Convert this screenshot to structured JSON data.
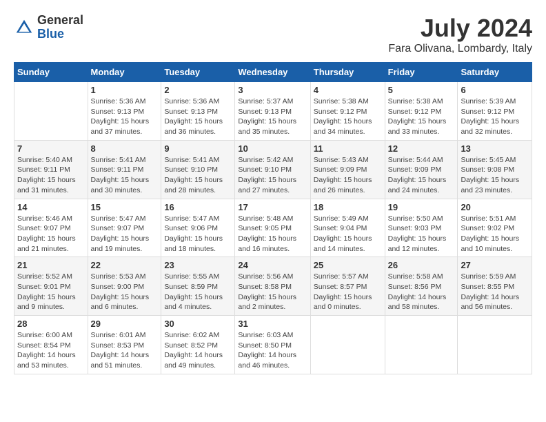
{
  "header": {
    "logo_line1": "General",
    "logo_line2": "Blue",
    "month_year": "July 2024",
    "location": "Fara Olivana, Lombardy, Italy"
  },
  "days_of_week": [
    "Sunday",
    "Monday",
    "Tuesday",
    "Wednesday",
    "Thursday",
    "Friday",
    "Saturday"
  ],
  "weeks": [
    [
      {
        "day": "",
        "content": ""
      },
      {
        "day": "1",
        "content": "Sunrise: 5:36 AM\nSunset: 9:13 PM\nDaylight: 15 hours\nand 37 minutes."
      },
      {
        "day": "2",
        "content": "Sunrise: 5:36 AM\nSunset: 9:13 PM\nDaylight: 15 hours\nand 36 minutes."
      },
      {
        "day": "3",
        "content": "Sunrise: 5:37 AM\nSunset: 9:13 PM\nDaylight: 15 hours\nand 35 minutes."
      },
      {
        "day": "4",
        "content": "Sunrise: 5:38 AM\nSunset: 9:12 PM\nDaylight: 15 hours\nand 34 minutes."
      },
      {
        "day": "5",
        "content": "Sunrise: 5:38 AM\nSunset: 9:12 PM\nDaylight: 15 hours\nand 33 minutes."
      },
      {
        "day": "6",
        "content": "Sunrise: 5:39 AM\nSunset: 9:12 PM\nDaylight: 15 hours\nand 32 minutes."
      }
    ],
    [
      {
        "day": "7",
        "content": "Sunrise: 5:40 AM\nSunset: 9:11 PM\nDaylight: 15 hours\nand 31 minutes."
      },
      {
        "day": "8",
        "content": "Sunrise: 5:41 AM\nSunset: 9:11 PM\nDaylight: 15 hours\nand 30 minutes."
      },
      {
        "day": "9",
        "content": "Sunrise: 5:41 AM\nSunset: 9:10 PM\nDaylight: 15 hours\nand 28 minutes."
      },
      {
        "day": "10",
        "content": "Sunrise: 5:42 AM\nSunset: 9:10 PM\nDaylight: 15 hours\nand 27 minutes."
      },
      {
        "day": "11",
        "content": "Sunrise: 5:43 AM\nSunset: 9:09 PM\nDaylight: 15 hours\nand 26 minutes."
      },
      {
        "day": "12",
        "content": "Sunrise: 5:44 AM\nSunset: 9:09 PM\nDaylight: 15 hours\nand 24 minutes."
      },
      {
        "day": "13",
        "content": "Sunrise: 5:45 AM\nSunset: 9:08 PM\nDaylight: 15 hours\nand 23 minutes."
      }
    ],
    [
      {
        "day": "14",
        "content": "Sunrise: 5:46 AM\nSunset: 9:07 PM\nDaylight: 15 hours\nand 21 minutes."
      },
      {
        "day": "15",
        "content": "Sunrise: 5:47 AM\nSunset: 9:07 PM\nDaylight: 15 hours\nand 19 minutes."
      },
      {
        "day": "16",
        "content": "Sunrise: 5:47 AM\nSunset: 9:06 PM\nDaylight: 15 hours\nand 18 minutes."
      },
      {
        "day": "17",
        "content": "Sunrise: 5:48 AM\nSunset: 9:05 PM\nDaylight: 15 hours\nand 16 minutes."
      },
      {
        "day": "18",
        "content": "Sunrise: 5:49 AM\nSunset: 9:04 PM\nDaylight: 15 hours\nand 14 minutes."
      },
      {
        "day": "19",
        "content": "Sunrise: 5:50 AM\nSunset: 9:03 PM\nDaylight: 15 hours\nand 12 minutes."
      },
      {
        "day": "20",
        "content": "Sunrise: 5:51 AM\nSunset: 9:02 PM\nDaylight: 15 hours\nand 10 minutes."
      }
    ],
    [
      {
        "day": "21",
        "content": "Sunrise: 5:52 AM\nSunset: 9:01 PM\nDaylight: 15 hours\nand 9 minutes."
      },
      {
        "day": "22",
        "content": "Sunrise: 5:53 AM\nSunset: 9:00 PM\nDaylight: 15 hours\nand 6 minutes."
      },
      {
        "day": "23",
        "content": "Sunrise: 5:55 AM\nSunset: 8:59 PM\nDaylight: 15 hours\nand 4 minutes."
      },
      {
        "day": "24",
        "content": "Sunrise: 5:56 AM\nSunset: 8:58 PM\nDaylight: 15 hours\nand 2 minutes."
      },
      {
        "day": "25",
        "content": "Sunrise: 5:57 AM\nSunset: 8:57 PM\nDaylight: 15 hours\nand 0 minutes."
      },
      {
        "day": "26",
        "content": "Sunrise: 5:58 AM\nSunset: 8:56 PM\nDaylight: 14 hours\nand 58 minutes."
      },
      {
        "day": "27",
        "content": "Sunrise: 5:59 AM\nSunset: 8:55 PM\nDaylight: 14 hours\nand 56 minutes."
      }
    ],
    [
      {
        "day": "28",
        "content": "Sunrise: 6:00 AM\nSunset: 8:54 PM\nDaylight: 14 hours\nand 53 minutes."
      },
      {
        "day": "29",
        "content": "Sunrise: 6:01 AM\nSunset: 8:53 PM\nDaylight: 14 hours\nand 51 minutes."
      },
      {
        "day": "30",
        "content": "Sunrise: 6:02 AM\nSunset: 8:52 PM\nDaylight: 14 hours\nand 49 minutes."
      },
      {
        "day": "31",
        "content": "Sunrise: 6:03 AM\nSunset: 8:50 PM\nDaylight: 14 hours\nand 46 minutes."
      },
      {
        "day": "",
        "content": ""
      },
      {
        "day": "",
        "content": ""
      },
      {
        "day": "",
        "content": ""
      }
    ]
  ]
}
